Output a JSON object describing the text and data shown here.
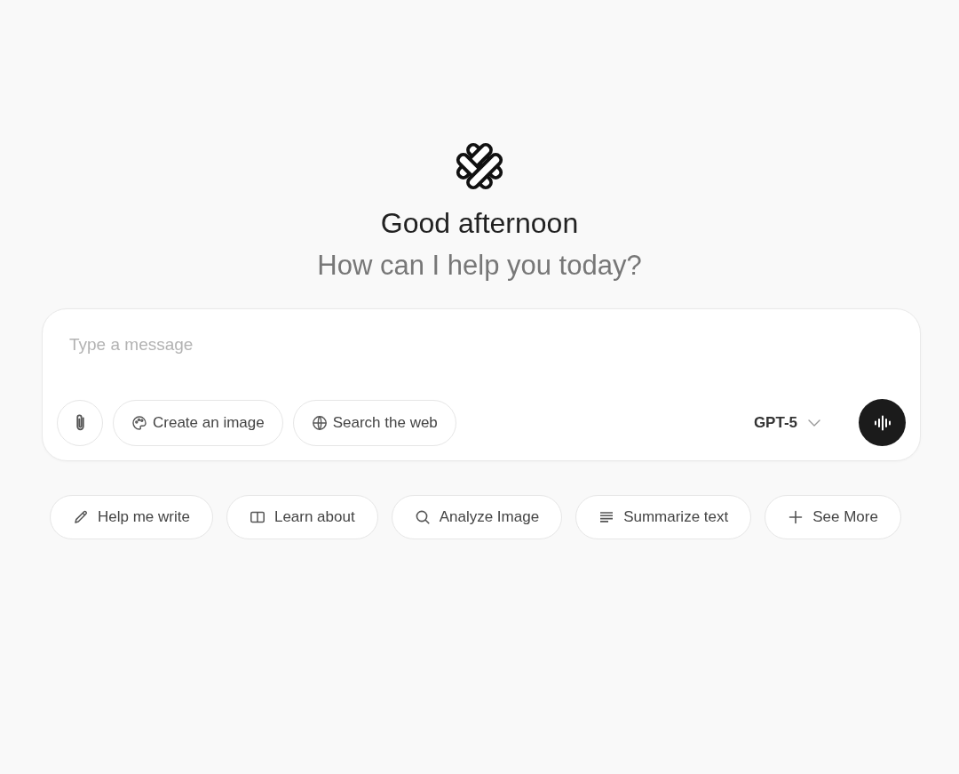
{
  "header": {
    "greeting": "Good afternoon",
    "subtitle": "How can I help you today?"
  },
  "composer": {
    "placeholder": "Type a message",
    "tools": [
      {
        "kind": "attach"
      },
      {
        "kind": "palette",
        "label": "Create an image"
      },
      {
        "kind": "globe",
        "label": "Search the web"
      }
    ],
    "model": {
      "label": "GPT-5"
    }
  },
  "suggestions": [
    {
      "kind": "pencil",
      "label": "Help me write"
    },
    {
      "kind": "book",
      "label": "Learn about"
    },
    {
      "kind": "magnifier",
      "label": "Analyze Image"
    },
    {
      "kind": "lines",
      "label": "Summarize text"
    },
    {
      "kind": "plus",
      "label": "See More"
    }
  ]
}
